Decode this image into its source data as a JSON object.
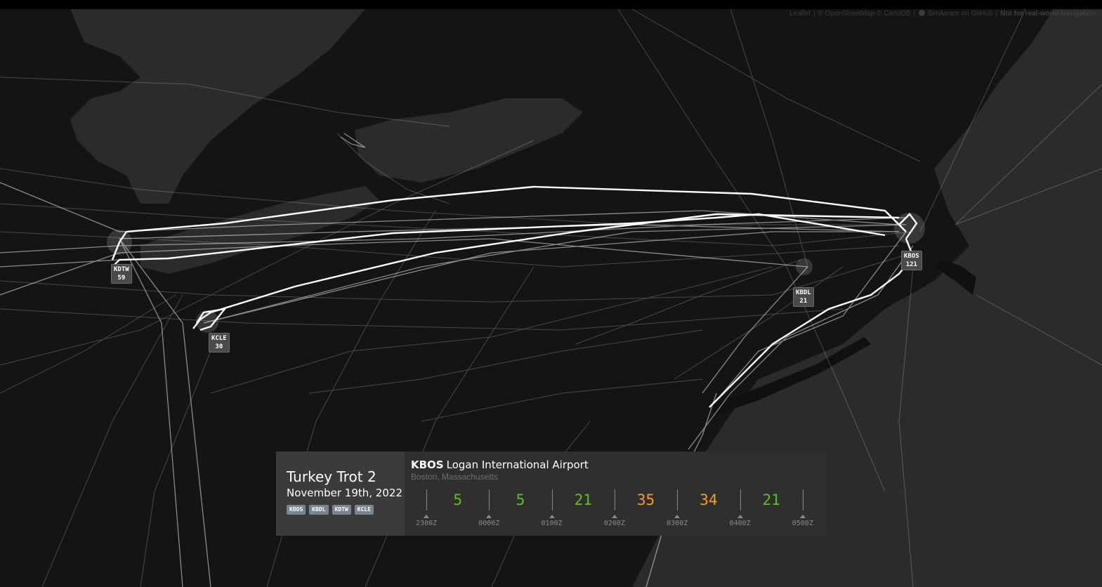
{
  "attribution": {
    "leaflet": "Leaflet",
    "osm": "© OpenStreetMap",
    "carto": "© CartoDB",
    "github": "SimAware on GitHub",
    "disclaimer": "Not for real-world navigation."
  },
  "airports": [
    {
      "code": "KDTW",
      "count": "59"
    },
    {
      "code": "KCLE",
      "count": "30"
    },
    {
      "code": "KBDL",
      "count": "21"
    },
    {
      "code": "KBOS",
      "count": "121"
    }
  ],
  "event": {
    "title": "Turkey Trot 2",
    "date": "November 19th, 2022",
    "tags": [
      "KBOS",
      "KBDL",
      "KDTW",
      "KCLE"
    ]
  },
  "airport_panel": {
    "code": "KBOS",
    "name": "Logan International Airport",
    "location": "Boston, Massachusetts",
    "times": [
      "2300Z",
      "0000Z",
      "0100Z",
      "0200Z",
      "0300Z",
      "0400Z",
      "0500Z"
    ],
    "counts": [
      {
        "value": "5",
        "color": "#5fbf2a"
      },
      {
        "value": "5",
        "color": "#5fbf2a"
      },
      {
        "value": "21",
        "color": "#5fbf2a"
      },
      {
        "value": "35",
        "color": "#f0a020"
      },
      {
        "value": "34",
        "color": "#f0a020"
      },
      {
        "value": "21",
        "color": "#5fbf2a"
      }
    ]
  },
  "colors": {
    "background": "#141414",
    "land": "#0f0f0f",
    "water": "#2b2b2b",
    "route": "#ffffff"
  },
  "icons": [
    "github-icon"
  ]
}
